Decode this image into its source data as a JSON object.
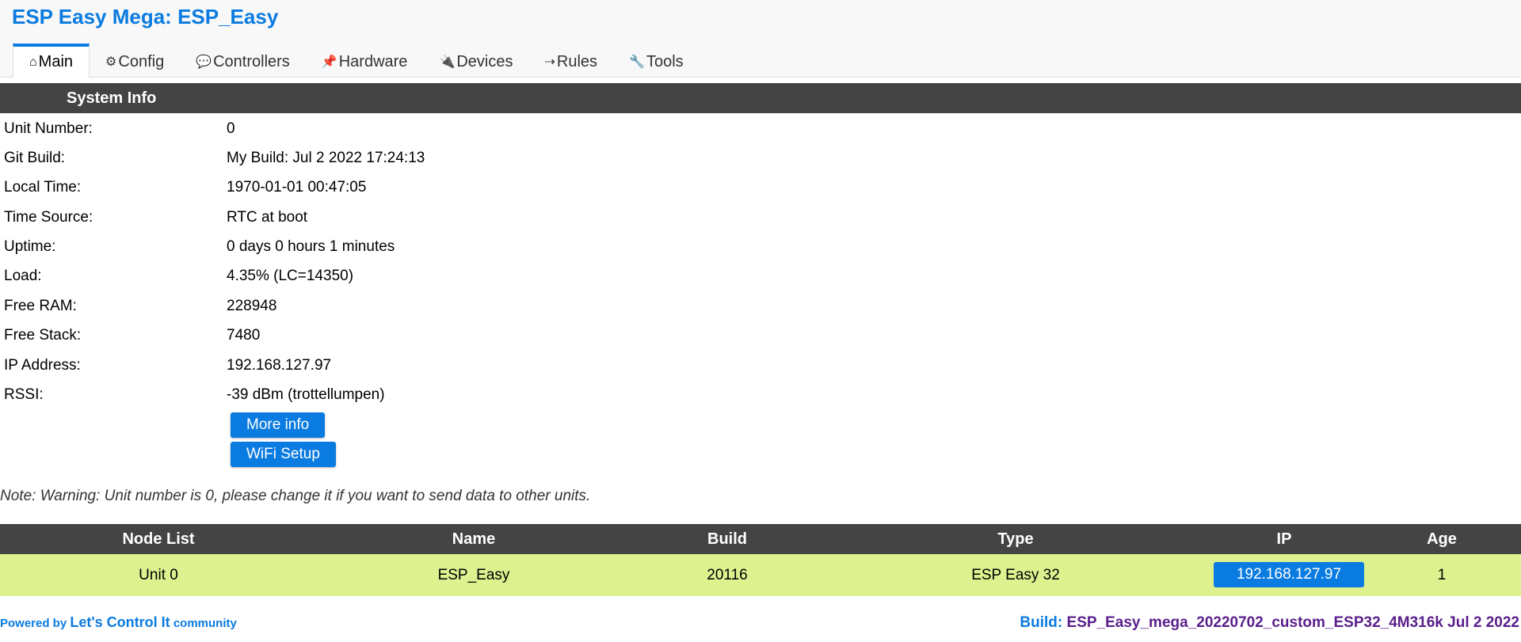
{
  "app": {
    "title": "ESP Easy Mega: ESP_Easy"
  },
  "tabs": [
    {
      "icon": "⌂",
      "label": "Main",
      "active": true
    },
    {
      "icon": "⚙",
      "label": "Config"
    },
    {
      "icon": "💬",
      "label": "Controllers"
    },
    {
      "icon": "📌",
      "label": "Hardware"
    },
    {
      "icon": "🔌",
      "label": "Devices"
    },
    {
      "icon": "⇢",
      "label": "Rules"
    },
    {
      "icon": "🔧",
      "label": "Tools"
    }
  ],
  "system_info": {
    "title": "System Info",
    "rows": [
      {
        "label": "Unit Number:",
        "value": "0"
      },
      {
        "label": "Git Build:",
        "value": "My Build: Jul 2 2022 17:24:13"
      },
      {
        "label": "Local Time:",
        "value": "1970-01-01 00:47:05"
      },
      {
        "label": "Time Source:",
        "value": "RTC at boot"
      },
      {
        "label": "Uptime:",
        "value": "0 days 0 hours 1 minutes"
      },
      {
        "label": "Load:",
        "value": "4.35% (LC=14350)"
      },
      {
        "label": "Free RAM:",
        "value": "228948"
      },
      {
        "label": "Free Stack:",
        "value": "7480"
      },
      {
        "label": "IP Address:",
        "value": "192.168.127.97"
      },
      {
        "label": "RSSI:",
        "value": "-39 dBm (trottellumpen)"
      }
    ],
    "more_info_label": "More info",
    "wifi_setup_label": "WiFi Setup"
  },
  "note": "Note: Warning: Unit number is 0, please change it if you want to send data to other units.",
  "node_list": {
    "headers": [
      "Node List",
      "Name",
      "Build",
      "Type",
      "IP",
      "Age"
    ],
    "rows": [
      {
        "unit": "Unit 0",
        "name": "ESP_Easy",
        "build": "20116",
        "type": "ESP Easy 32",
        "ip": "192.168.127.97",
        "age": "1"
      }
    ]
  },
  "footer": {
    "powered_by": "Powered by",
    "community_name": "Let's Control It",
    "community_suffix": "community",
    "build_label": "Build:",
    "build_value": "ESP_Easy_mega_20220702_custom_ESP32_4M316k Jul 2 2022"
  },
  "colors": {
    "accent": "#0a7be0",
    "header_bar": "#444444",
    "row_highlight": "#ddf18f",
    "build_text": "#5a1e8c"
  }
}
